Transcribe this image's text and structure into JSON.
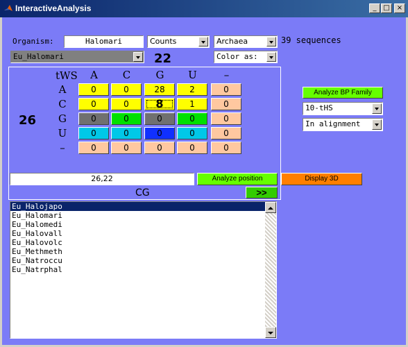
{
  "window": {
    "title": "InteractiveAnalysis",
    "minimize": "_",
    "maximize": "□",
    "close": "×"
  },
  "header": {
    "organism_label": "Organism:",
    "organism_value": "Halomari",
    "mode_value": "Counts",
    "domain_value": "Archaea",
    "seq_count": "39 sequences",
    "selected_seq": "Eu_Halomari",
    "col_number": "22",
    "color_as": "Color as:",
    "row_number": "26"
  },
  "matrix": {
    "corner": "tWS",
    "col_headers": [
      "A",
      "C",
      "G",
      "U",
      "–"
    ],
    "row_headers": [
      "A",
      "C",
      "G",
      "U",
      "–"
    ],
    "rows": [
      [
        "0",
        "0",
        "28",
        "2",
        "0"
      ],
      [
        "0",
        "0",
        "8",
        "1",
        "0"
      ],
      [
        "0",
        "0",
        "0",
        "0",
        "0"
      ],
      [
        "0",
        "0",
        "0",
        "0",
        "0"
      ],
      [
        "0",
        "0",
        "0",
        "0",
        "0"
      ]
    ],
    "colors": [
      [
        "#ffff00",
        "#ffff00",
        "#ffff00",
        "#ffff00",
        "#ffc8a0"
      ],
      [
        "#ffff00",
        "#ffff00",
        "#ffff00",
        "#ffff00",
        "#ffc8a0"
      ],
      [
        "#707070",
        "#00e000",
        "#707070",
        "#00e000",
        "#ffc8a0"
      ],
      [
        "#00c8e8",
        "#00c8e8",
        "#1030ff",
        "#00c8e8",
        "#ffc8a0"
      ],
      [
        "#ffc8a0",
        "#ffc8a0",
        "#ffc8a0",
        "#ffc8a0",
        "#ffc8a0"
      ]
    ]
  },
  "bottom": {
    "position_value": "26,22",
    "analyze_position": "Analyze position",
    "display_3d": "Display 3D",
    "pair": "CG",
    "next": ">>"
  },
  "right": {
    "analyze_bp": "Analyze BP Family",
    "family": "10-tHS",
    "alignment": "In alignment"
  },
  "sequences": [
    "Eu_Halojapo",
    "Eu_Halomari",
    "Eu_Halomedi",
    "Eu_Halovall",
    "Eu_Halovolc",
    "Eu_Methmeth",
    "Eu_Natroccu",
    "Eu_Natrphal"
  ]
}
